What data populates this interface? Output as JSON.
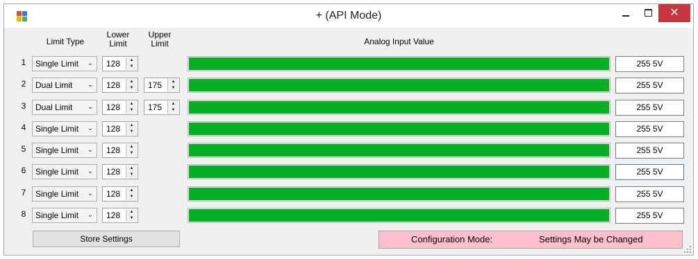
{
  "window": {
    "title": "+ (API Mode)",
    "close_glyph": "✕"
  },
  "headers": {
    "limit_type": "Limit Type",
    "lower_limit_1": "Lower",
    "lower_limit_2": "Limit",
    "upper_limit_1": "Upper",
    "upper_limit_2": "Limit",
    "analog": "Analog Input Value"
  },
  "rows": [
    {
      "num": "1",
      "type": "Single Limit",
      "lower": "128",
      "upper": null,
      "level": 1.0,
      "value": "255  5V"
    },
    {
      "num": "2",
      "type": "Dual Limit",
      "lower": "128",
      "upper": "175",
      "level": 1.0,
      "value": "255  5V"
    },
    {
      "num": "3",
      "type": "Dual Limit",
      "lower": "128",
      "upper": "175",
      "level": 1.0,
      "value": "255  5V"
    },
    {
      "num": "4",
      "type": "Single Limit",
      "lower": "128",
      "upper": null,
      "level": 1.0,
      "value": "255  5V"
    },
    {
      "num": "5",
      "type": "Single Limit",
      "lower": "128",
      "upper": null,
      "level": 1.0,
      "value": "255  5V"
    },
    {
      "num": "6",
      "type": "Single Limit",
      "lower": "128",
      "upper": null,
      "level": 1.0,
      "value": "255  5V"
    },
    {
      "num": "7",
      "type": "Single Limit",
      "lower": "128",
      "upper": null,
      "level": 1.0,
      "value": "255  5V"
    },
    {
      "num": "8",
      "type": "Single Limit",
      "lower": "128",
      "upper": null,
      "level": 1.0,
      "value": "255  5V"
    }
  ],
  "store_button": "Store Settings",
  "status": {
    "label": "Configuration Mode:",
    "message": "Settings May be Changed",
    "color": "#ffc0cb"
  },
  "colors": {
    "bar": "#06b025",
    "close": "#c7363a"
  },
  "icons": {
    "app": "app-icon",
    "dropdown": "chevron-down-icon",
    "spin_up": "arrow-up-icon",
    "spin_down": "arrow-down-icon"
  }
}
